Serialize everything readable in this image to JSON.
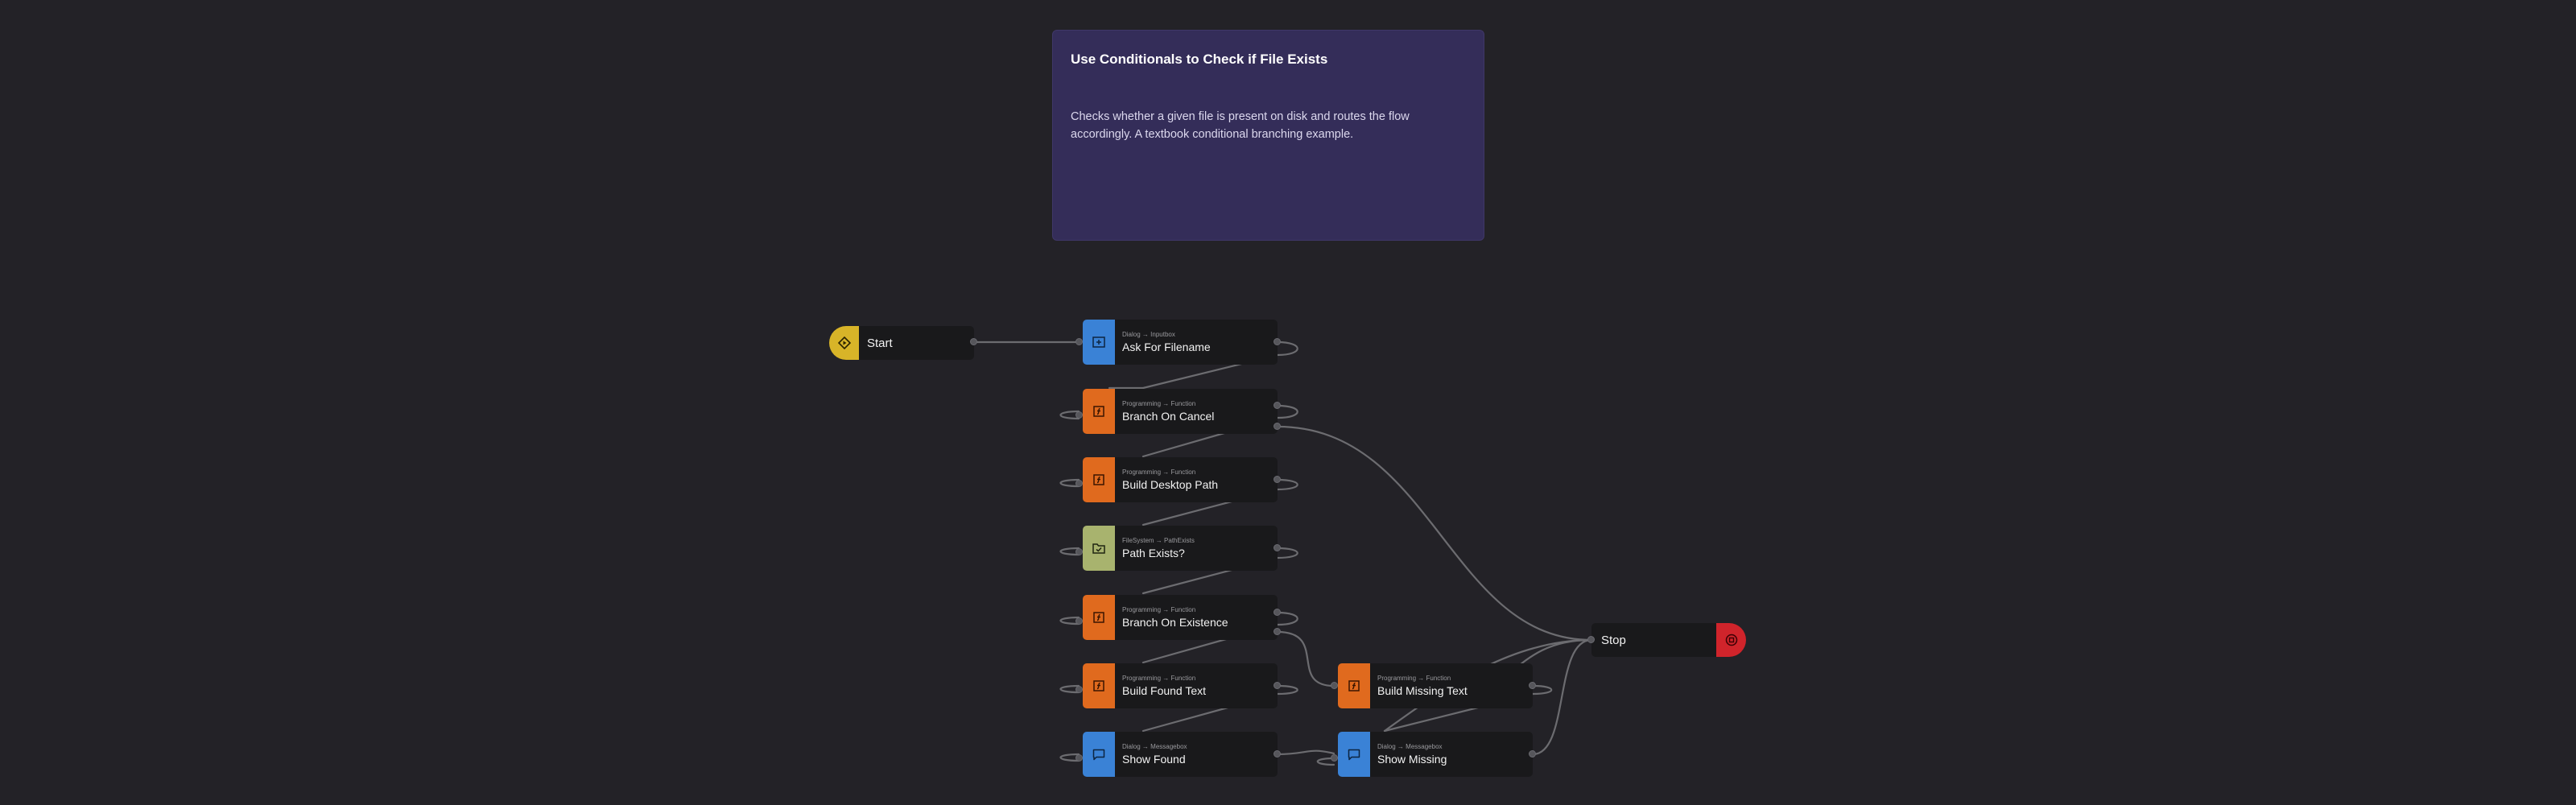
{
  "comment": {
    "title": "Use Conditionals to Check if File Exists",
    "body": "Checks whether a given file is present on disk and routes the flow accordingly. A textbook conditional branching example."
  },
  "nodes": {
    "start": {
      "title": "Start",
      "icon": "play-diamond-icon",
      "color": "#d8b428"
    },
    "stop": {
      "title": "Stop",
      "icon": "stop-icon",
      "color": "#d0242b"
    },
    "ask_filename": {
      "category": "Dialog",
      "type": "Inputbox",
      "title": "Ask For Filename",
      "icon": "input-box-icon",
      "color": "#3a82d6"
    },
    "branch_cancel": {
      "category": "Programming",
      "type": "Function",
      "title": "Branch On Cancel",
      "icon": "function-icon",
      "color": "#e06a1e"
    },
    "build_desktop_path": {
      "category": "Programming",
      "type": "Function",
      "title": "Build Desktop Path",
      "icon": "function-icon",
      "color": "#e06a1e"
    },
    "path_exists": {
      "category": "FileSystem",
      "type": "PathExists",
      "title": "Path Exists?",
      "icon": "folder-check-icon",
      "color": "#a8b36e"
    },
    "branch_existence": {
      "category": "Programming",
      "type": "Function",
      "title": "Branch On Existence",
      "icon": "function-icon",
      "color": "#e06a1e"
    },
    "build_found_text": {
      "category": "Programming",
      "type": "Function",
      "title": "Build Found Text",
      "icon": "function-icon",
      "color": "#e06a1e"
    },
    "show_found": {
      "category": "Dialog",
      "type": "Messagebox",
      "title": "Show Found",
      "icon": "message-box-icon",
      "color": "#3a82d6"
    },
    "build_missing_text": {
      "category": "Programming",
      "type": "Function",
      "title": "Build Missing Text",
      "icon": "function-icon",
      "color": "#e06a1e"
    },
    "show_missing": {
      "category": "Dialog",
      "type": "Messagebox",
      "title": "Show Missing",
      "icon": "message-box-icon",
      "color": "#3a82d6"
    }
  },
  "arrow_glyph": "→"
}
